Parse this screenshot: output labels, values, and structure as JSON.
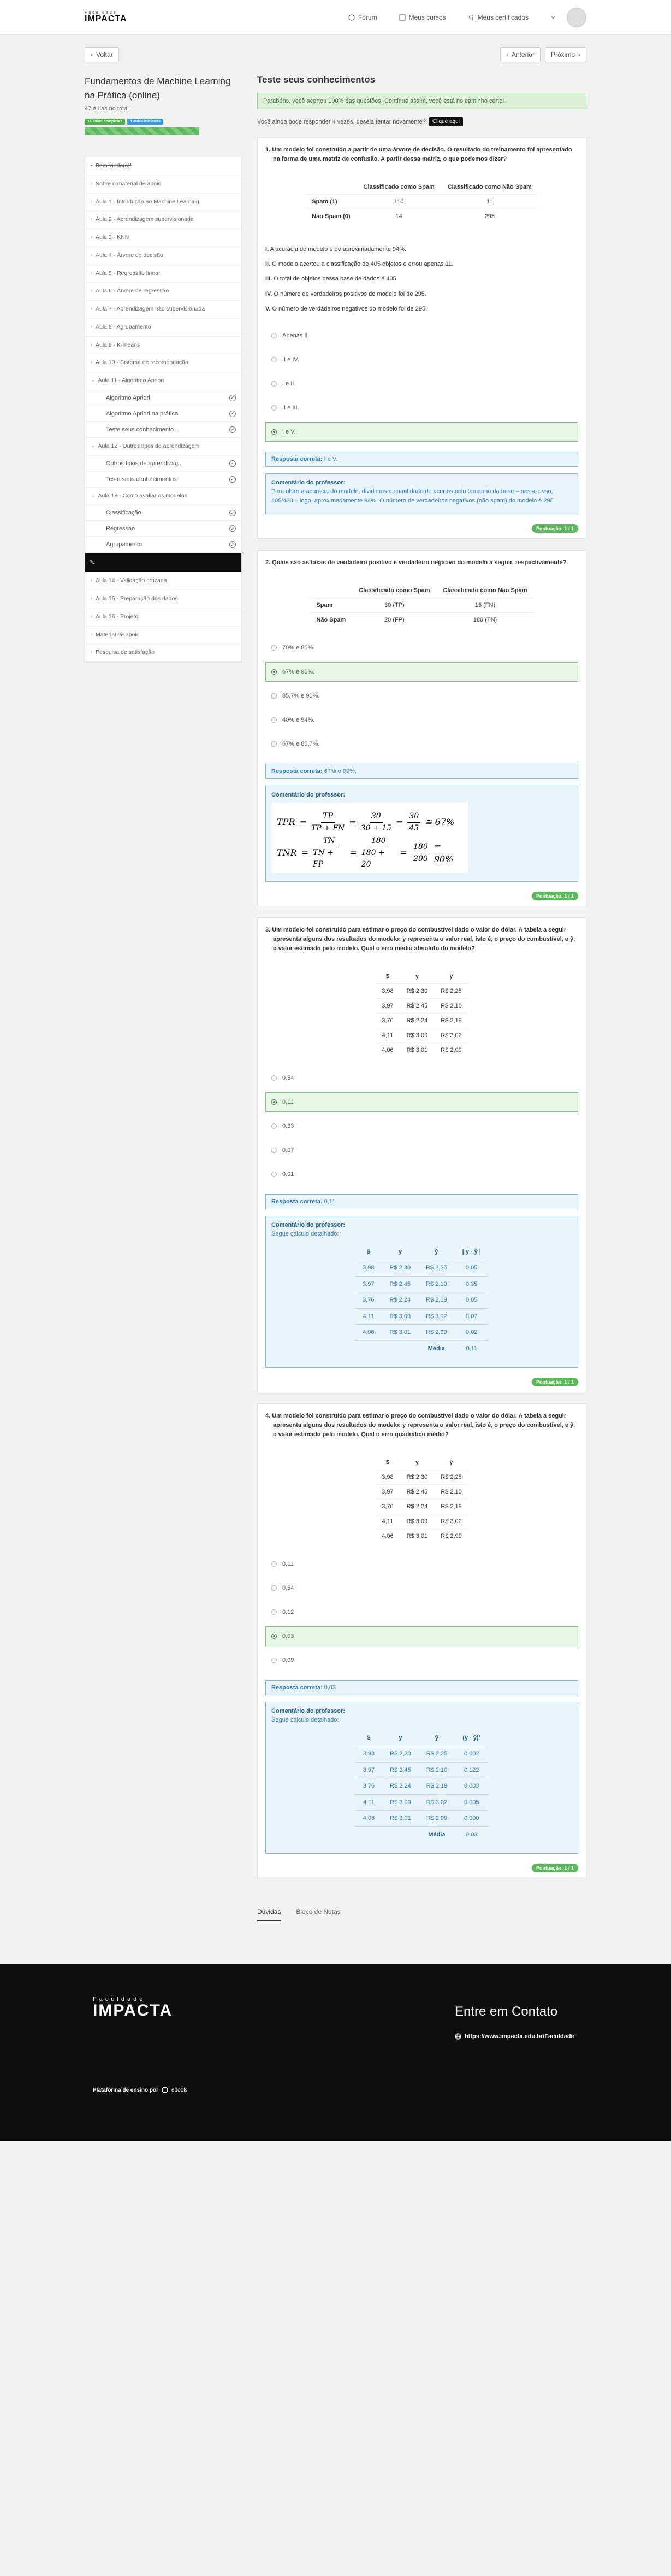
{
  "header": {
    "logo_small": "Faculdade",
    "logo_big": "IMPACTA",
    "nav": [
      "Fórum",
      "Meus cursos",
      "Meus certificados"
    ]
  },
  "navigation": {
    "back": "Voltar",
    "prev": "Anterior",
    "next": "Próximo"
  },
  "sidebar": {
    "course_title": "Fundamentos de Machine Learning na Prática (online)",
    "lessons_total": "47 aulas no total",
    "badge_done": "16 aulas completas",
    "badge_started": "1 aulas iniciadas",
    "progress_percent": 34,
    "items": [
      "Bem-vindo(a)!",
      "Sobre o material de apoio",
      "Aula 1 - Introdução ao Machine Learning",
      "Aula 2 - Aprendizagem supervisionada",
      "Aula 3 - KNN",
      "Aula 4 - Árvore de decisão",
      "Aula 5 - Regressão linear",
      "Aula 6 - Árvore de regressão",
      "Aula 7 - Aprendizagem não supervisionada",
      "Aula 8 - Agrupamento",
      "Aula 9 - K-means",
      "Aula 10 - Sistema de recomendação",
      "Aula 11 - Algoritmo Apriori"
    ],
    "aula11_sub": [
      "Algoritmo Apriori",
      "Algoritmo Apriori na prática",
      "Teste seus conhecimento..."
    ],
    "aula12": "Aula 12 - Outros tipos de aprendizagem",
    "aula12_sub": [
      "Outros tipos de aprendizag...",
      "Teste seus conhecimentos"
    ],
    "aula13": "Aula 13 - Como avaliar os modelos",
    "aula13_sub": [
      "Classificação",
      "Regressão",
      "Agrupamento"
    ],
    "after": [
      "Aula 14 - Validação cruzada",
      "Aula 15 - Preparação dos dados",
      "Aula 16 - Projeto",
      "Material de apoio",
      "Pesquisa de satisfação"
    ]
  },
  "main": {
    "title": "Teste seus conhecimentos",
    "success": "Parabéns, você acertou 100% das questões. Continue assim, você está no caminho certo!",
    "retry_text": "Você ainda pode responder 4 vezes, deseja tentar novamente?",
    "retry_button": "Clique aqui",
    "answer_label": "Resposta correta:",
    "comment_label": "Comentário do professor:",
    "score": "Pontuação: 1 / 1"
  },
  "q1": {
    "text": "1. Um modelo foi construído a partir de uma árvore de decisão. O resultado do treinamento foi apresentado na forma de uma matriz de confusão. A partir dessa matriz, o que podemos dizer?",
    "headers": [
      "",
      "Classificado como Spam",
      "Classificado como Não Spam"
    ],
    "rows": [
      [
        "Spam (1)",
        "110",
        "11"
      ],
      [
        "Não Spam (0)",
        "14",
        "295"
      ]
    ],
    "statements": [
      [
        "I.",
        " A acurácia do modelo é de aproximadamente 94%."
      ],
      [
        "II.",
        " O modelo acertou a classificação de 405 objetos e errou apenas 11."
      ],
      [
        "III.",
        " O total de objetos dessa base de dados é 405."
      ],
      [
        "IV.",
        " O número de verdadeiros positivos do modelo foi de 295."
      ],
      [
        "V.",
        " O número de verdadeiros negativos do modelo foi de 295."
      ]
    ],
    "options": [
      "Apenas II.",
      "II e IV.",
      "I e II.",
      "II e III.",
      "I e V."
    ],
    "correct": "I e V.",
    "comment": "Para obter a acurácia do modelo, dividimos a quantidade de acertos pelo tamanho da base – nesse caso, 405/430 – logo, aproximadamente 94%. O número de verdadeiros negativos (não spam) do modelo é 295."
  },
  "q2": {
    "text": "2. Quais são as taxas de verdadeiro positivo e verdadeiro negativo do modelo a seguir, respectivamente?",
    "headers": [
      "",
      "Classificado como Spam",
      "Classificado como Não Spam"
    ],
    "rows": [
      [
        "Spam",
        "30 (TP)",
        "15 (FN)"
      ],
      [
        "Não Spam",
        "20 (FP)",
        "180 (TN)"
      ]
    ],
    "options": [
      "70% e 85%.",
      "67% e 90%.",
      "85,7% e 90%.",
      "40% e 94%.",
      "67% e 85,7%."
    ],
    "correct": "67% e 90%.",
    "f1": {
      "lhs": "TPR",
      "n1": "TP",
      "d1": "TP + FN",
      "n2": "30",
      "d2": "30 + 15",
      "n3": "30",
      "d3": "45",
      "res": "≅ 67%"
    },
    "f2": {
      "lhs": "TNR",
      "n1": "TN",
      "d1": "TN + FP",
      "n2": "180",
      "d2": "180 + 20",
      "n3": "180",
      "d3": "200",
      "res": "= 90%"
    }
  },
  "q3": {
    "text": "3. Um modelo foi construído para estimar o preço do combustível dado o valor do dólar. A tabela a seguir apresenta alguns dos resultados do modelo: y representa o valor real, isto é, o preço do combustível, e ŷ, o valor estimado pelo modelo. Qual o erro médio absoluto do modelo?",
    "headers": [
      "$",
      "y",
      "ŷ"
    ],
    "rows": [
      [
        "3,98",
        "R$ 2,30",
        "R$ 2,25"
      ],
      [
        "3,97",
        "R$ 2,45",
        "R$ 2,10"
      ],
      [
        "3,76",
        "R$ 2,24",
        "R$ 2,19"
      ],
      [
        "4,11",
        "R$ 3,09",
        "R$ 3,02"
      ],
      [
        "4,06",
        "R$ 3,01",
        "R$ 2,99"
      ]
    ],
    "options": [
      "0,54",
      "0,11",
      "0,33",
      "0,07",
      "0,01"
    ],
    "correct": "0,11",
    "comment_sub": "Segue cálculo detalhado:",
    "ctable_headers": [
      "$",
      "y",
      "ŷ",
      "| y - ŷ |"
    ],
    "ctable_rows": [
      [
        "3,98",
        "R$ 2,30",
        "R$ 2,25",
        "0,05"
      ],
      [
        "3,97",
        "R$ 2,45",
        "R$ 2,10",
        "0,35"
      ],
      [
        "3,76",
        "R$ 2,24",
        "R$ 2,19",
        "0,05"
      ],
      [
        "4,11",
        "R$ 3,09",
        "R$ 3,02",
        "0,07"
      ],
      [
        "4,06",
        "R$ 3,01",
        "R$ 2,99",
        "0,02"
      ]
    ],
    "ctable_footer": [
      "Média",
      "0,11"
    ]
  },
  "q4": {
    "text": "4. Um modelo foi construído para estimar o preço do combustível dado o valor do dólar. A tabela a seguir apresenta alguns dos resultados do modelo: y representa o valor real, isto é, o preço do combustível, e ŷ, o valor estimado pelo modelo. Qual o erro quadrático médio?",
    "headers": [
      "$",
      "y",
      "ŷ"
    ],
    "rows": [
      [
        "3,98",
        "R$ 2,30",
        "R$ 2,25"
      ],
      [
        "3,97",
        "R$ 2,45",
        "R$ 2,10"
      ],
      [
        "3,76",
        "R$ 2,24",
        "R$ 2,19"
      ],
      [
        "4,11",
        "R$ 3,09",
        "R$ 3,02"
      ],
      [
        "4,06",
        "R$ 3,01",
        "R$ 2,99"
      ]
    ],
    "options": [
      "0,11",
      "0,54",
      "0,12",
      "0,03",
      "0,09"
    ],
    "correct": "0,03",
    "comment_sub": "Segue cálculo detalhado:",
    "ctable_headers": [
      "$",
      "y",
      "ŷ",
      "(y - ŷ)²"
    ],
    "ctable_rows": [
      [
        "3,98",
        "R$ 2,30",
        "R$ 2,25",
        "0,002"
      ],
      [
        "3,97",
        "R$ 2,45",
        "R$ 2,10",
        "0,122"
      ],
      [
        "3,76",
        "R$ 2,24",
        "R$ 2,19",
        "0,003"
      ],
      [
        "4,11",
        "R$ 3,09",
        "R$ 3,02",
        "0,005"
      ],
      [
        "4,06",
        "R$ 3,01",
        "R$ 2,99",
        "0,000"
      ]
    ],
    "ctable_footer": [
      "Média",
      "0,03"
    ]
  },
  "bottom_tabs": [
    "Dúvidas",
    "Bloco de Notas"
  ],
  "footer": {
    "logo_small": "Faculdade",
    "logo_big": "IMPACTA",
    "contact": "Entre em Contato",
    "link": "https://www.impacta.edu.br/Faculdade",
    "platform": "Plataforma de ensino por",
    "platform_brand": "edools"
  }
}
